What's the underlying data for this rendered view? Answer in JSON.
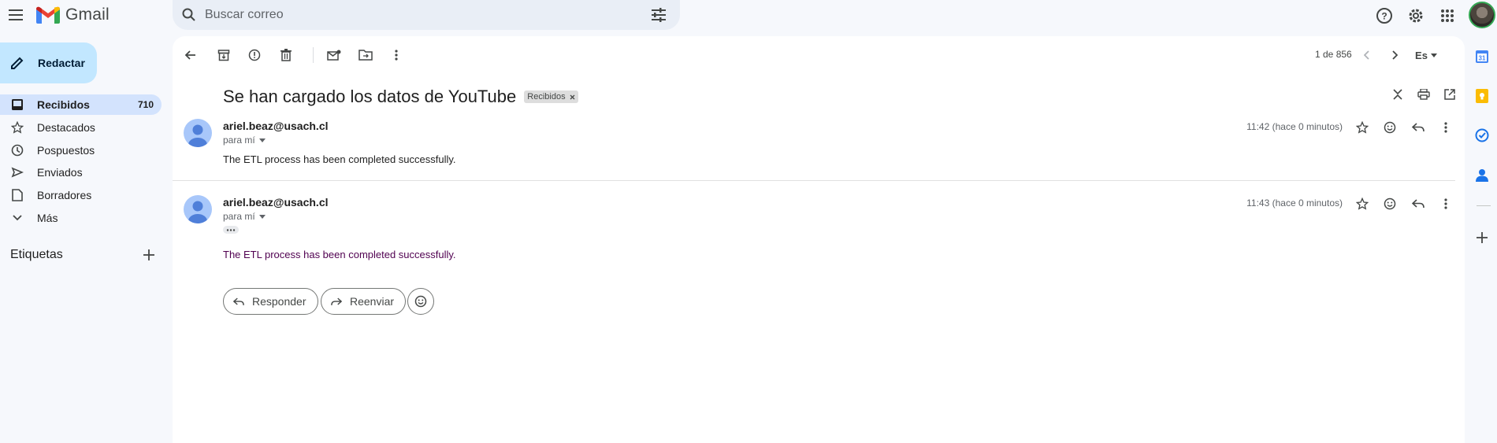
{
  "app": {
    "name": "Gmail"
  },
  "search": {
    "placeholder": "Buscar correo"
  },
  "sidebar": {
    "compose_label": "Redactar",
    "items": [
      {
        "label": "Recibidos",
        "count": "710",
        "icon": "inbox-icon"
      },
      {
        "label": "Destacados",
        "count": "",
        "icon": "star-icon"
      },
      {
        "label": "Pospuestos",
        "count": "",
        "icon": "clock-icon"
      },
      {
        "label": "Enviados",
        "count": "",
        "icon": "send-icon"
      },
      {
        "label": "Borradores",
        "count": "",
        "icon": "draft-icon"
      },
      {
        "label": "Más",
        "count": "",
        "icon": "chevron-down-icon"
      }
    ],
    "labels_heading": "Etiquetas"
  },
  "toolbar": {
    "pager": "1 de 856",
    "input_tool": "Es"
  },
  "thread": {
    "subject": "Se han cargado los datos de YouTube",
    "label_chip": "Recibidos",
    "messages": [
      {
        "sender": "ariel.beaz@usach.cl",
        "to": "para mí",
        "time": "11:42 (hace 0 minutos)",
        "body": "The ETL process has been completed successfully."
      },
      {
        "sender": "ariel.beaz@usach.cl",
        "to": "para mí",
        "time": "11:43 (hace 0 minutos)",
        "body": "The ETL process has been completed successfully."
      }
    ],
    "reply_label": "Responder",
    "forward_label": "Reenviar"
  },
  "colors": {
    "compose_bg": "#c2e7ff",
    "active_nav_bg": "#d3e3fd",
    "visited_body": "#500050",
    "page_bg": "#f6f8fc"
  }
}
